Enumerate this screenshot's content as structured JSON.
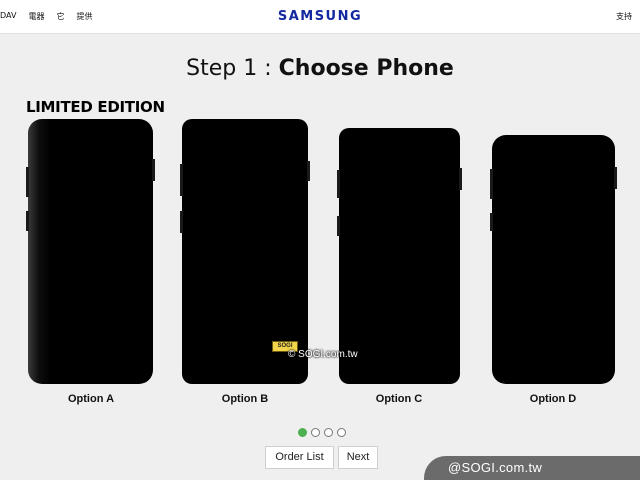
{
  "header": {
    "nav_left": [
      "DAV",
      "電器",
      "它",
      "提供"
    ],
    "brand": "SAMSUNG",
    "nav_right": "支持"
  },
  "step": {
    "prefix": "Step 1 : ",
    "title": "Choose Phone"
  },
  "badge": "LIMITED EDITION",
  "options": [
    {
      "label": "Option A"
    },
    {
      "label": "Option B"
    },
    {
      "label": "Option C"
    },
    {
      "label": "Option D"
    }
  ],
  "pagination": {
    "total": 4,
    "active": 1
  },
  "buttons": {
    "order_list": "Order List",
    "next": "Next"
  },
  "watermark": {
    "badge": "SOGI",
    "text": "© SOGI.com.tw"
  },
  "corner_tag": "@SOGI.com.tw",
  "colors": {
    "brand": "#1428a0",
    "active_dot": "#4caf50",
    "corner_tag_bg": "#6b6b6b"
  }
}
